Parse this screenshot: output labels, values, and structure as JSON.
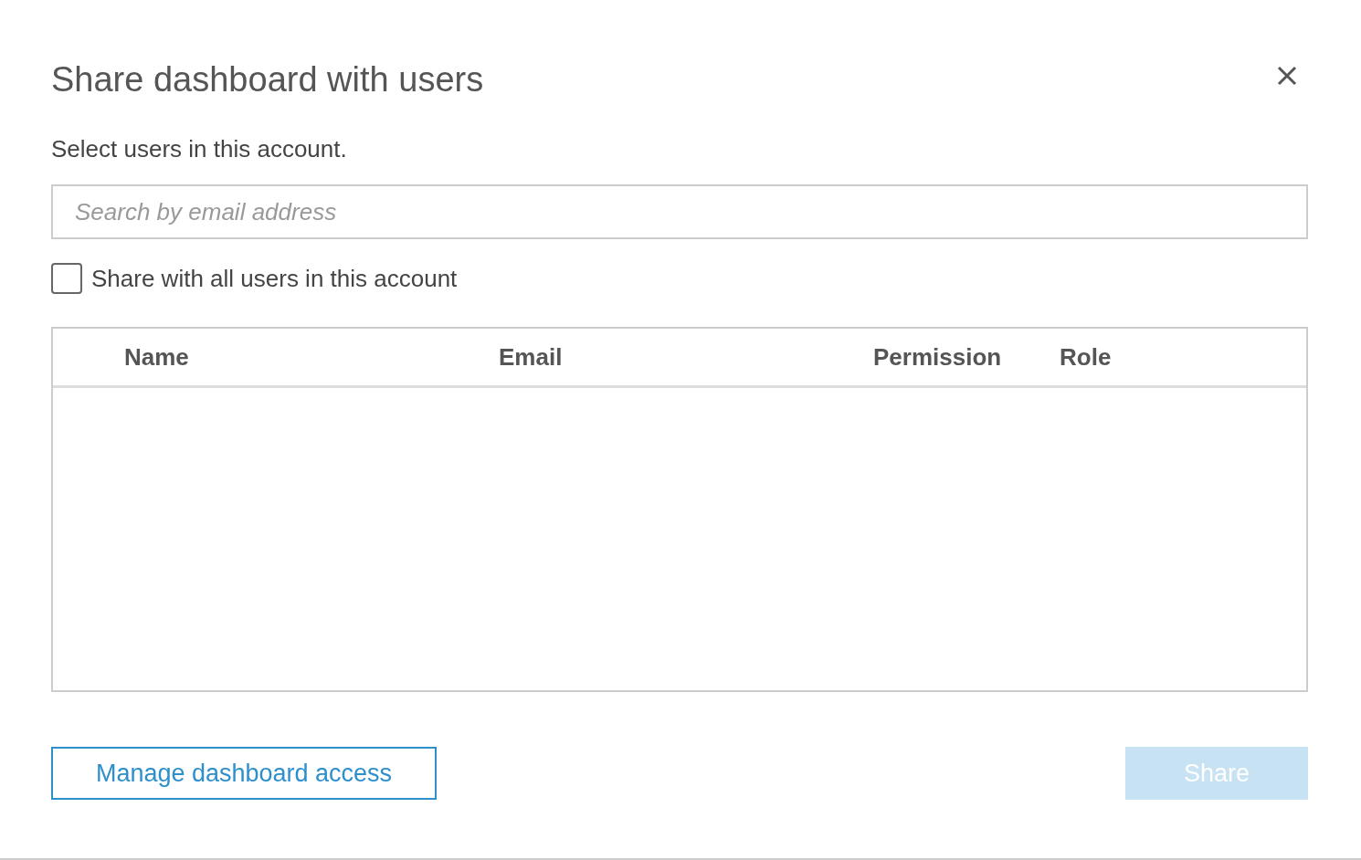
{
  "dialog": {
    "title": "Share dashboard with users",
    "subtitle": "Select users in this account."
  },
  "search": {
    "placeholder": "Search by email address"
  },
  "share_all": {
    "label": "Share with all users in this account",
    "checked": false
  },
  "table": {
    "columns": [
      "Name",
      "Email",
      "Permission",
      "Role"
    ]
  },
  "buttons": [
    {
      "label": "Manage dashboard access",
      "kind": "secondary",
      "disabled": false
    },
    {
      "label": "Share",
      "kind": "primary",
      "disabled": true
    }
  ]
}
